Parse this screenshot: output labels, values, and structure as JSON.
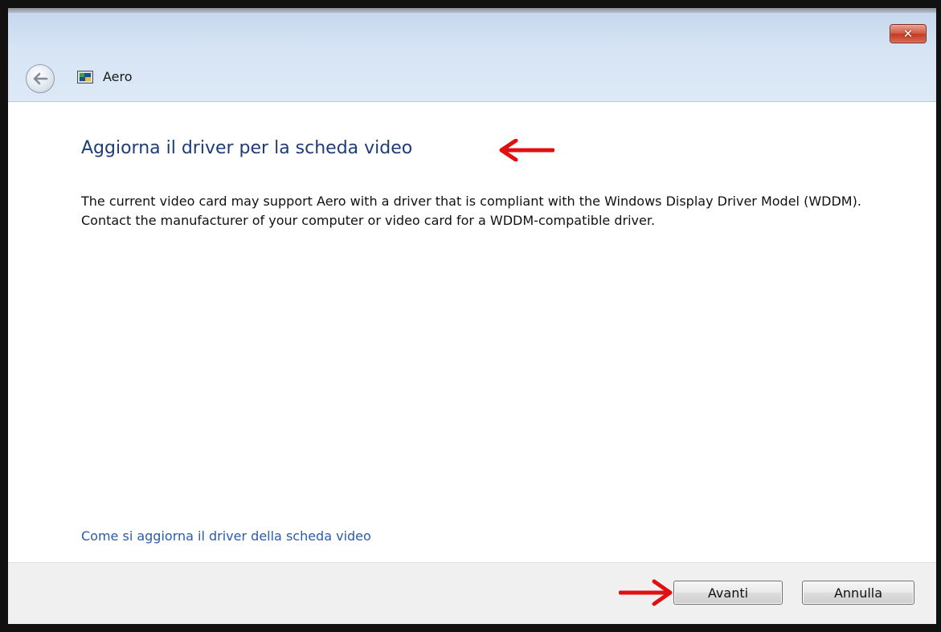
{
  "window": {
    "title": "Aero",
    "close_icon": "close-icon",
    "back_icon": "back-arrow-icon",
    "app_icon": "display-icon"
  },
  "content": {
    "heading": "Aggiorna il driver per la scheda video",
    "description": "The current video card may support Aero with a driver that is compliant with the Windows Display Driver Model (WDDM).  Contact the manufacturer of your computer or video card for a WDDM-compatible driver.",
    "help_link": "Come si aggiorna il driver della scheda video"
  },
  "footer": {
    "next_label": "Avanti",
    "cancel_label": "Annulla"
  },
  "annotations": {
    "arrow_color": "#e01010",
    "arrow_icon": "red-arrow-icon"
  },
  "colors": {
    "heading": "#1e3c78",
    "link": "#2a5bb0",
    "close_button": "#c23a22"
  }
}
